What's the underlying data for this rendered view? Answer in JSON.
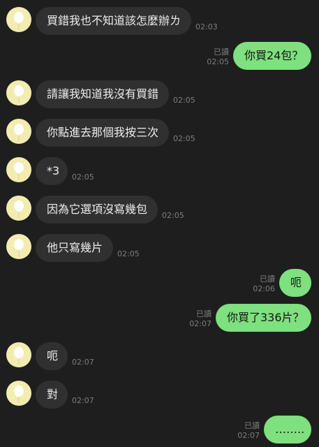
{
  "colors": {
    "background": "#1e1e1e",
    "incoming_bubble": "#303030",
    "outgoing_bubble": "#7ee07e",
    "avatar": "#f2ecb0",
    "meta_text": "#7d7d7d"
  },
  "avatar_icon": "balloon-icon",
  "messages": [
    {
      "side": "in",
      "text": "買錯我也不知道該怎麼辦ㄌ",
      "time": "02:03"
    },
    {
      "side": "out",
      "text": "你買24包？",
      "read": "已讀",
      "time": "02:05"
    },
    {
      "side": "in",
      "text": "請讓我知道我沒有買錯",
      "time": "02:05"
    },
    {
      "side": "in",
      "text": "你點進去那個我按三次",
      "time": "02:05"
    },
    {
      "side": "in",
      "text": "*3",
      "time": "02:05"
    },
    {
      "side": "in",
      "text": "因為它選項沒寫幾包",
      "time": "02:05"
    },
    {
      "side": "in",
      "text": "他只寫幾片",
      "time": "02:05"
    },
    {
      "side": "out",
      "text": "呃",
      "read": "已讀",
      "time": "02:06"
    },
    {
      "side": "out",
      "text": "你買了336片？",
      "read": "已讀",
      "time": "02:07"
    },
    {
      "side": "in",
      "text": "呃",
      "time": "02:07"
    },
    {
      "side": "in",
      "text": "對",
      "time": "02:07"
    },
    {
      "side": "out",
      "text": "……..",
      "read": "已讀",
      "time": "02:07"
    }
  ]
}
